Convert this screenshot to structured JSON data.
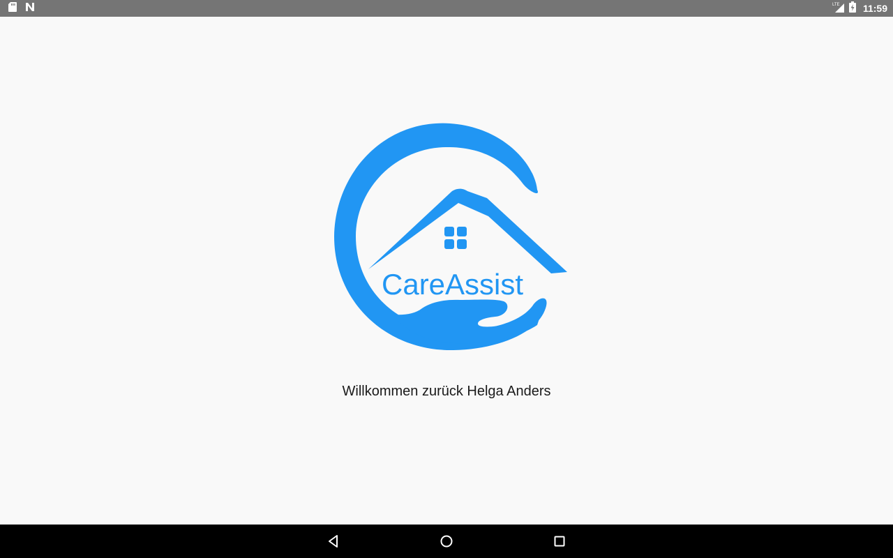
{
  "status_bar": {
    "time": "11:59",
    "network_label": "LTE",
    "left_icons": [
      "sd-card-icon",
      "n-notification-icon"
    ],
    "right_icons": [
      "lte-signal-icon",
      "battery-charging-icon"
    ]
  },
  "logo": {
    "brand_text": "CareAssist",
    "brand_color": "#2196f3"
  },
  "welcome": {
    "message": "Willkommen zurück Helga Anders"
  },
  "nav_bar": {
    "buttons": [
      "back-icon",
      "home-icon",
      "recents-icon"
    ]
  },
  "colors": {
    "status_bar_bg": "#757575",
    "content_bg": "#f9f9f9",
    "nav_bar_bg": "#000000",
    "accent": "#2196f3"
  }
}
